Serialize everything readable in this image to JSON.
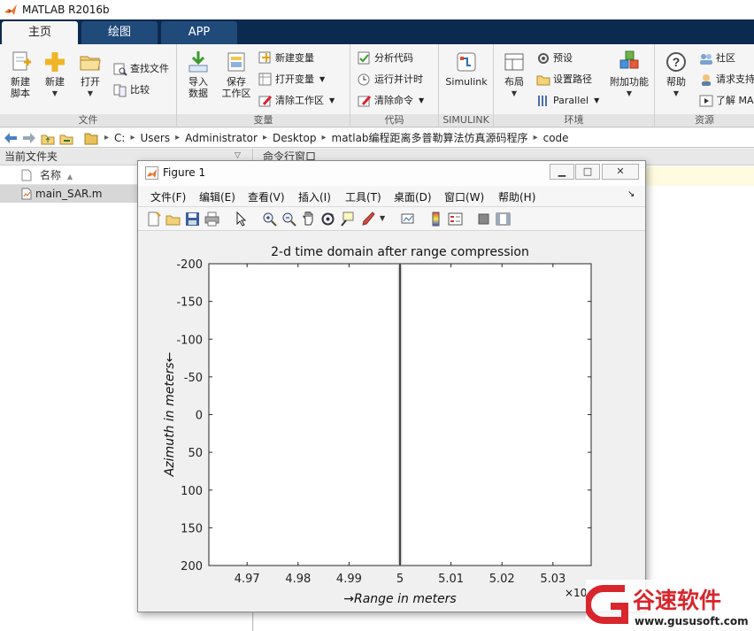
{
  "app": {
    "title": "MATLAB R2016b"
  },
  "tabs": [
    {
      "label": "主页",
      "active": true
    },
    {
      "label": "绘图",
      "active": false
    },
    {
      "label": "APP",
      "active": false
    }
  ],
  "ribbon": {
    "file": {
      "label": "文件",
      "new_script": [
        "新建",
        "脚本"
      ],
      "new": "新建",
      "open": "打开",
      "find_files": "查找文件",
      "compare": "比较"
    },
    "variable": {
      "label": "变量",
      "import_data": [
        "导入",
        "数据"
      ],
      "save_workspace": [
        "保存",
        "工作区"
      ],
      "new_variable": "新建变量",
      "open_variable": "打开变量",
      "clear_workspace": "清除工作区"
    },
    "code": {
      "label": "代码",
      "analyze_code": "分析代码",
      "run_and_time": "运行并计时",
      "clear_commands": "清除命令"
    },
    "simulink": {
      "label": "SIMULINK",
      "button": "Simulink"
    },
    "environment": {
      "label": "环境",
      "layout": "布局",
      "preferences": "预设",
      "set_path": "设置路径",
      "parallel": "Parallel",
      "addons": "附加功能"
    },
    "resources": {
      "label": "资源",
      "help": "帮助",
      "community": "社区",
      "request_support": "请求支持",
      "learn_matlab": "了解 MA"
    }
  },
  "address": {
    "crumbs": [
      "C:",
      "Users",
      "Administrator",
      "Desktop",
      "matlab编程距离多普勒算法仿真源码程序",
      "code"
    ]
  },
  "current_folder": {
    "title": "当前文件夹",
    "column_name": "名称",
    "files": [
      "main_SAR.m"
    ]
  },
  "command_window": {
    "title": "命令行窗口"
  },
  "figure": {
    "title": "Figure 1",
    "menus": [
      "文件(F)",
      "编辑(E)",
      "查看(V)",
      "插入(I)",
      "工具(T)",
      "桌面(D)",
      "窗口(W)",
      "帮助(H)"
    ]
  },
  "chart_data": {
    "type": "line",
    "title": "2-d time domain after range compression",
    "xlabel": "→Range in meters",
    "ylabel": "Azimuth in meters←",
    "x_exponent_label": "×10",
    "xlim": [
      4.9625,
      5.0375
    ],
    "ylim": [
      -200,
      200
    ],
    "y_reversed": true,
    "xticks": [
      4.97,
      4.98,
      4.99,
      5,
      5.01,
      5.02,
      5.03
    ],
    "xtick_labels": [
      "4.97",
      "4.98",
      "4.99",
      "5",
      "5.01",
      "5.02",
      "5.03"
    ],
    "yticks": [
      -200,
      -150,
      -100,
      -50,
      0,
      50,
      100,
      150,
      200
    ],
    "ytick_labels": [
      "-200",
      "-150",
      "-100",
      "-50",
      "0",
      "50",
      "100",
      "150",
      "200"
    ],
    "grid": false,
    "series": [
      {
        "x": [
          5.0,
          5.0
        ],
        "y": [
          -200,
          200
        ],
        "color": "#444444"
      }
    ]
  },
  "watermark": {
    "brand": "谷速软件",
    "url": "www.gususoft.com",
    "color": "#d8262c"
  }
}
